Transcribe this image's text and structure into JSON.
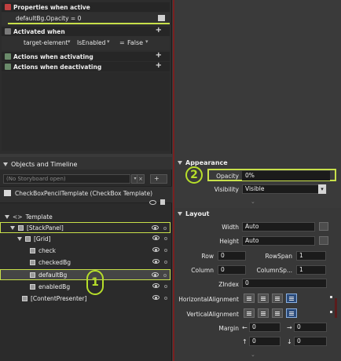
{
  "triggers": {
    "properties_when_active": "Properties when active",
    "active_value": "defaultBg.Opacity = 0",
    "activated_when": "Activated when",
    "condition": {
      "element": "target-element",
      "property": "IsEnabled",
      "operator": "=",
      "value": "False"
    },
    "actions_activating": "Actions when activating",
    "actions_deactivating": "Actions when deactivating"
  },
  "objects": {
    "title": "Objects and Timeline",
    "storyboard_placeholder": "(No Storyboard open)",
    "add_label": "+",
    "template_scope": "CheckBoxPencilTemplate (CheckBox Template)",
    "tree": [
      {
        "label": "Template",
        "level": 0
      },
      {
        "label": "[StackPanel]",
        "level": 1
      },
      {
        "label": "[Grid]",
        "level": 2
      },
      {
        "label": "check",
        "level": 3
      },
      {
        "label": "checkedBg",
        "level": 3
      },
      {
        "label": "defaultBg",
        "level": 3
      },
      {
        "label": "enabledBg",
        "level": 3
      },
      {
        "label": "[ContentPresenter]",
        "level": 2
      }
    ]
  },
  "annotations": {
    "one": "1",
    "two": "2"
  },
  "appearance": {
    "title": "Appearance",
    "opacity_label": "Opacity",
    "opacity_value": "0%",
    "visibility_label": "Visibility",
    "visibility_value": "Visible"
  },
  "layout": {
    "title": "Layout",
    "width_label": "Width",
    "width_value": "Auto",
    "height_label": "Height",
    "height_value": "Auto",
    "row_label": "Row",
    "row_value": "0",
    "rowspan_label": "RowSpan",
    "rowspan_value": "1",
    "column_label": "Column",
    "column_value": "0",
    "columnspan_label": "ColumnSp...",
    "columnspan_value": "1",
    "zindex_label": "ZIndex",
    "zindex_value": "0",
    "halign_label": "HorizontalAlignment",
    "valign_label": "VerticalAlignment",
    "margin_label": "Margin",
    "margin_values": [
      "0",
      "0",
      "0",
      "0"
    ]
  },
  "colors": {
    "highlight": "#c8e04a",
    "annotation": "#b6de2a",
    "divider": "#7a2020"
  }
}
